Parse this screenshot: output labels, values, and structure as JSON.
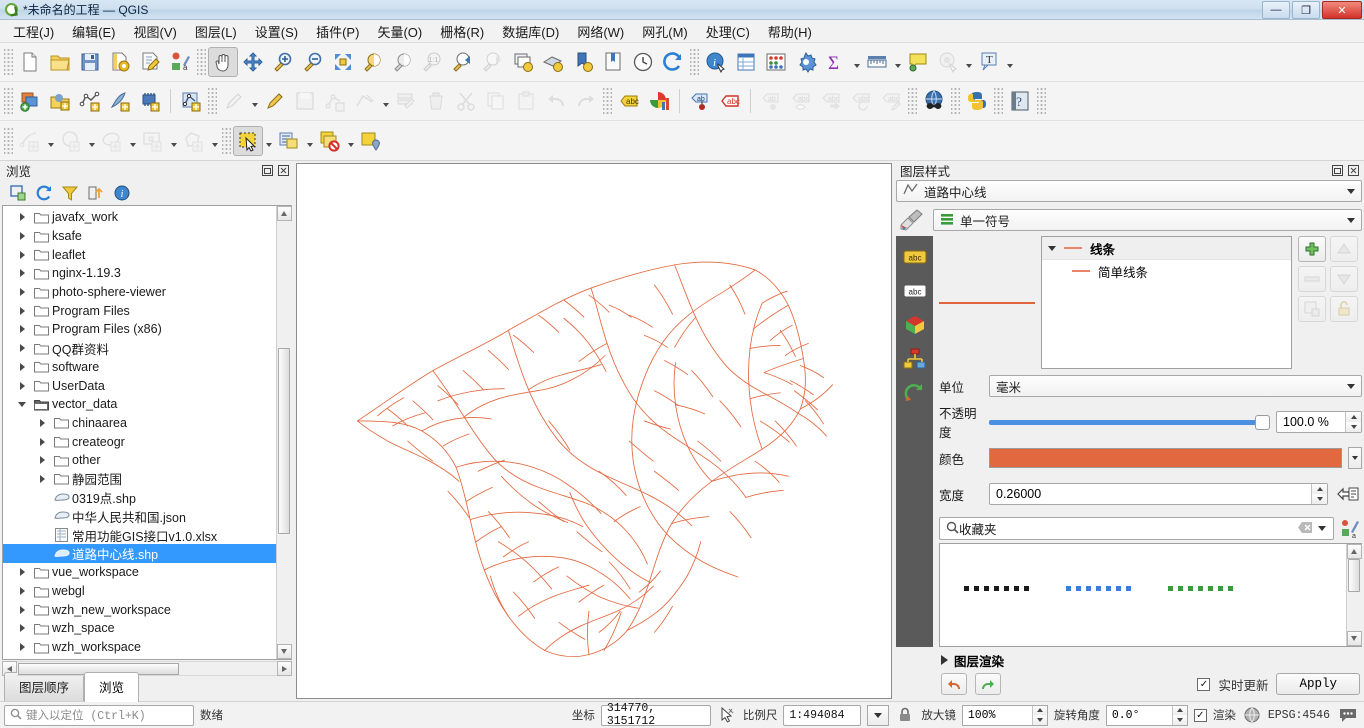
{
  "window": {
    "title": "*未命名的工程 — QGIS",
    "logo_icon": "qgis-logo-icon",
    "minimize_label": "—",
    "maximize_label": "❐",
    "close_label": "✕"
  },
  "menubar": {
    "items": [
      {
        "label": "工程(J)"
      },
      {
        "label": "编辑(E)"
      },
      {
        "label": "视图(V)"
      },
      {
        "label": "图层(L)"
      },
      {
        "label": "设置(S)"
      },
      {
        "label": "插件(P)"
      },
      {
        "label": "矢量(O)"
      },
      {
        "label": "栅格(R)"
      },
      {
        "label": "数据库(D)"
      },
      {
        "label": "网络(W)"
      },
      {
        "label": "网孔(M)"
      },
      {
        "label": "处理(C)"
      },
      {
        "label": "帮助(H)"
      }
    ]
  },
  "toolbars": {
    "row1": [
      {
        "name": "new-project-icon"
      },
      {
        "name": "open-project-icon"
      },
      {
        "name": "save-project-icon"
      },
      {
        "name": "save-project-as-icon"
      },
      {
        "name": "new-print-layout-icon"
      },
      {
        "name": "style-manager-icon"
      },
      {
        "name": "pan-map-icon",
        "active": true
      },
      {
        "name": "pan-to-selection-icon"
      },
      {
        "name": "zoom-in-icon"
      },
      {
        "name": "zoom-out-icon"
      },
      {
        "name": "zoom-full-icon"
      },
      {
        "name": "zoom-to-selection-icon"
      },
      {
        "name": "zoom-to-layer-icon"
      },
      {
        "name": "zoom-native-icon",
        "disabled": true
      },
      {
        "name": "zoom-last-icon"
      },
      {
        "name": "zoom-next-icon",
        "disabled": true
      },
      {
        "name": "new-map-view-icon"
      },
      {
        "name": "new-3d-map-view-icon"
      },
      {
        "name": "new-bookmark-icon"
      },
      {
        "name": "show-bookmarks-icon"
      },
      {
        "name": "temporal-controller-icon"
      },
      {
        "name": "refresh-icon"
      },
      {
        "name": "identify-features-icon"
      },
      {
        "name": "open-attribute-table-icon"
      },
      {
        "name": "statistical-summary-icon"
      },
      {
        "name": "processing-toolbox-icon"
      },
      {
        "name": "sum-expression-icon"
      },
      {
        "name": "measure-line-icon"
      },
      {
        "name": "map-tips-icon"
      },
      {
        "name": "show-spatial-bookmarks-icon",
        "disabled": true
      },
      {
        "name": "new-text-annotation-icon"
      }
    ],
    "row2": [
      {
        "name": "add-vector-layer-icon"
      },
      {
        "name": "add-raster-layer-icon"
      },
      {
        "name": "add-delimited-text-layer-icon"
      },
      {
        "name": "add-spatialite-layer-icon"
      },
      {
        "name": "add-postgis-layer-icon"
      },
      {
        "name": "add-virtual-layer-icon"
      },
      {
        "name": "current-edits-icon",
        "disabled": true
      },
      {
        "name": "toggle-editing-icon"
      },
      {
        "name": "save-layer-edits-icon",
        "disabled": true
      },
      {
        "name": "add-feature-icon",
        "disabled": true
      },
      {
        "name": "vertex-tool-icon",
        "disabled": true
      },
      {
        "name": "modify-attributes-icon",
        "disabled": true
      },
      {
        "name": "delete-selected-icon",
        "disabled": true
      },
      {
        "name": "cut-features-icon",
        "disabled": true
      },
      {
        "name": "copy-features-icon",
        "disabled": true
      },
      {
        "name": "paste-features-icon",
        "disabled": true
      },
      {
        "name": "undo-icon",
        "disabled": true
      },
      {
        "name": "redo-icon",
        "disabled": true
      },
      {
        "name": "show-labels-icon"
      },
      {
        "name": "diagram-properties-icon"
      },
      {
        "name": "pin-labels-icon"
      },
      {
        "name": "highlight-labels-icon"
      },
      {
        "name": "move-label-icon",
        "disabled": true
      },
      {
        "name": "show-hide-labels-icon",
        "disabled": true
      },
      {
        "name": "move-label-diagram-icon",
        "disabled": true
      },
      {
        "name": "rotate-label-icon",
        "disabled": true
      },
      {
        "name": "change-label-icon",
        "disabled": true
      },
      {
        "name": "metasearch-icon"
      },
      {
        "name": "python-console-icon"
      },
      {
        "name": "help-icon"
      }
    ],
    "row3": [
      {
        "name": "digitize-line-icon",
        "disabled": true
      },
      {
        "name": "digitize-circle-icon",
        "disabled": true
      },
      {
        "name": "digitize-ellipse-icon",
        "disabled": true
      },
      {
        "name": "digitize-rectangle-icon",
        "disabled": true
      },
      {
        "name": "digitize-polygon-icon",
        "disabled": true
      },
      {
        "name": "select-features-icon",
        "active": true
      },
      {
        "name": "select-by-expression-icon"
      },
      {
        "name": "deselect-features-icon"
      },
      {
        "name": "select-value-icon"
      }
    ]
  },
  "browser_panel": {
    "title": "浏览",
    "dock_icon": "undock-icon",
    "close_icon": "close-icon",
    "toolbar": [
      {
        "name": "add-favourite-icon"
      },
      {
        "name": "refresh-icon"
      },
      {
        "name": "filter-browser-icon"
      },
      {
        "name": "collapse-all-icon"
      },
      {
        "name": "properties-icon"
      }
    ],
    "tree": [
      {
        "label": "javafx_work",
        "type": "folder",
        "depth": 1,
        "expandable": true
      },
      {
        "label": "ksafe",
        "type": "folder",
        "depth": 1,
        "expandable": true
      },
      {
        "label": "leaflet",
        "type": "folder",
        "depth": 1,
        "expandable": true
      },
      {
        "label": "nginx-1.19.3",
        "type": "folder",
        "depth": 1,
        "expandable": true
      },
      {
        "label": "photo-sphere-viewer",
        "type": "folder",
        "depth": 1,
        "expandable": true
      },
      {
        "label": "Program Files",
        "type": "folder",
        "depth": 1,
        "expandable": true
      },
      {
        "label": "Program Files (x86)",
        "type": "folder",
        "depth": 1,
        "expandable": true
      },
      {
        "label": "QQ群资料",
        "type": "folder",
        "depth": 1,
        "expandable": true
      },
      {
        "label": "software",
        "type": "folder",
        "depth": 1,
        "expandable": true
      },
      {
        "label": "UserData",
        "type": "folder",
        "depth": 1,
        "expandable": true
      },
      {
        "label": "vector_data",
        "type": "folder-open",
        "depth": 1,
        "expandable": true,
        "expanded": true
      },
      {
        "label": "chinaarea",
        "type": "folder",
        "depth": 2,
        "expandable": true
      },
      {
        "label": "createogr",
        "type": "folder",
        "depth": 2,
        "expandable": true
      },
      {
        "label": "other",
        "type": "folder",
        "depth": 2,
        "expandable": true
      },
      {
        "label": "静园范围",
        "type": "folder",
        "depth": 2,
        "expandable": true
      },
      {
        "label": "0319点.shp",
        "type": "vector",
        "depth": 2,
        "expandable": false
      },
      {
        "label": "中华人民共和国.json",
        "type": "vector",
        "depth": 2,
        "expandable": false
      },
      {
        "label": "常用功能GIS接口v1.0.xlsx",
        "type": "sheet",
        "depth": 2,
        "expandable": false
      },
      {
        "label": "道路中心线.shp",
        "type": "vector",
        "depth": 2,
        "expandable": false,
        "selected": true
      },
      {
        "label": "vue_workspace",
        "type": "folder",
        "depth": 1,
        "expandable": true
      },
      {
        "label": "webgl",
        "type": "folder",
        "depth": 1,
        "expandable": true
      },
      {
        "label": "wzh_new_workspace",
        "type": "folder",
        "depth": 1,
        "expandable": true
      },
      {
        "label": "wzh_space",
        "type": "folder",
        "depth": 1,
        "expandable": true
      },
      {
        "label": "wzh_workspace",
        "type": "folder",
        "depth": 1,
        "expandable": true
      }
    ],
    "tabs": [
      {
        "label": "图层顺序",
        "selected": false
      },
      {
        "label": "浏览",
        "selected": true
      }
    ]
  },
  "styling_panel": {
    "title": "图层样式",
    "dock_icon": "undock-icon",
    "close_icon": "close-icon",
    "layer_select": {
      "value": "道路中心线",
      "icon": "line-layer-icon"
    },
    "renderer_select": {
      "value": "单一符号",
      "icon": "single-symbol-icon"
    },
    "paintbrush_icon": "paintbrush-icon",
    "side_tabs": [
      {
        "name": "labels-tab",
        "icon": "abc-label-icon"
      },
      {
        "name": "masks-tab",
        "icon": "abc-mask-icon"
      },
      {
        "name": "3d-view-tab",
        "icon": "cube-icon"
      },
      {
        "name": "diagrams-tab",
        "icon": "diagram-icon"
      },
      {
        "name": "history-tab",
        "icon": "undo-history-icon"
      }
    ],
    "symbol_tree": {
      "root": "线条",
      "child": "简单线条"
    },
    "symbol_buttons": [
      {
        "name": "add-symbol-layer-button"
      },
      {
        "name": "move-symbol-up-button"
      },
      {
        "name": "remove-symbol-layer-button"
      },
      {
        "name": "move-symbol-down-button"
      },
      {
        "name": "duplicate-symbol-layer-button"
      },
      {
        "name": "lock-symbol-layer-button"
      }
    ],
    "unit": {
      "label": "单位",
      "value": "毫米"
    },
    "opacity": {
      "label": "不透明度",
      "value": "100.0 %",
      "percent": 100
    },
    "color": {
      "label": "颜色",
      "value": "#e2683f"
    },
    "width": {
      "label": "宽度",
      "value": "0.26000",
      "data_define_icon": "data-defined-override-icon"
    },
    "search": {
      "value": "收藏夹",
      "search_icon": "search-icon",
      "clear_icon": "clear-icon",
      "dropdown_icon": "chevron-down-icon",
      "style_manager_icon": "style-manager-icon"
    },
    "gallery_symbols": [
      {
        "name": "dashed-black-symbol",
        "color": "#1a1a1a"
      },
      {
        "name": "dashed-blue-symbol",
        "color": "#3b7dd8"
      },
      {
        "name": "dashed-green-symbol",
        "color": "#3a9b3a"
      }
    ],
    "layer_rendering": {
      "label": "图层渲染"
    },
    "footer": {
      "undo_icon": "undo-icon",
      "redo_icon": "redo-icon",
      "live_update_label": "实时更新",
      "live_update_checked": true,
      "apply_label": "Apply"
    }
  },
  "statusbar": {
    "locator_placeholder": "键入以定位 (Ctrl+K)",
    "locator_icon": "search-icon",
    "ready_text": "数绪",
    "coordinate_label": "坐标",
    "coordinate_value": "314770, 3151712",
    "coord_toggle_icon": "mouse-coordinate-icon",
    "scale_label": "比例尺",
    "scale_value": "1:494084",
    "lock_icon": "lock-scale-icon",
    "magnifier_label": "放大镜",
    "magnifier_value": "100%",
    "rotation_label": "旋转角度",
    "rotation_value": "0.0°",
    "render_label": "渲染",
    "render_checked": true,
    "crs_icon": "crs-globe-icon",
    "crs_value": "EPSG:4546",
    "messages_icon": "messages-log-icon"
  },
  "map": {
    "background": "#ffffff",
    "line_color": "#e2683f"
  }
}
